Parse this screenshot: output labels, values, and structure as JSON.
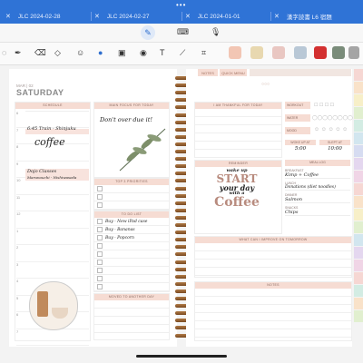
{
  "tabs": [
    {
      "label": "JLC 2024-02-28"
    },
    {
      "label": "JLC 2024-02-27"
    },
    {
      "label": "JLC 2024-01-01"
    },
    {
      "label": "漢字読書 L6 宿題"
    }
  ],
  "nav": {
    "notes_label": "NOTES",
    "quick_menu_label": "QUICK MENU"
  },
  "date": {
    "month_day": "MAR | 02",
    "weekday": "SATURDAY"
  },
  "left": {
    "schedule_title": "SCHEDULE",
    "schedule_entries": [
      {
        "label": "6:45 Train - Shinjuku",
        "time_row": 1
      },
      {
        "label": "coffee",
        "time_row": 2
      },
      {
        "label": "Dojo Classes",
        "time_row": 5
      },
      {
        "label": "Marunouchi - Nishiwaseda",
        "time_row": 5
      }
    ],
    "hour_labels": [
      "6",
      "7",
      "8",
      "9",
      "10",
      "11",
      "12",
      "1",
      "2",
      "3",
      "4",
      "5",
      "6",
      "7"
    ],
    "main_focus_title": "MAIN FOCUS FOR TODAY",
    "main_focus_text": "Don't over due it!",
    "top_priorities_title": "TOP 3 PRIORITIES",
    "todo_title": "TO DO LIST",
    "todo_items": [
      "Buy - New iPad case",
      "Buy - Bananas",
      "Buy - Popcorn"
    ],
    "moved_title": "MOVED TO ANOTHER DAY"
  },
  "right": {
    "thankful_title": "I AM THANKFUL FOR TODAY",
    "tracker_labels": [
      "WORKOUT",
      "WATER",
      "MOOD"
    ],
    "woke_up_label": "WOKE UP AT",
    "slept_label": "SLEPT AT",
    "woke_up_value": "5:00",
    "slept_value": "10:00",
    "reminder_title": "REMINDER",
    "reminder_art": [
      "wake up",
      "START",
      "your day",
      "with a",
      "Coffee"
    ],
    "meal_title": "MEAL LOG",
    "meal_rows": [
      {
        "label": "BREAKFAST",
        "value": "Kimp + Coffee"
      },
      {
        "label": "LUNCH",
        "value": "Donations (diet noodles)"
      },
      {
        "label": "DINNER",
        "value": "Salmon"
      },
      {
        "label": "SNACKS",
        "value": "Chips"
      }
    ],
    "improve_title": "WHAT CAN I IMPROVE ON TOMORROW",
    "notes_title": "NOTES"
  },
  "colors": {
    "tabbar": "#2f73d6",
    "accent_pink": "#f6dcd3",
    "text_brown": "#8a6a60",
    "ring": "#9a6636"
  }
}
